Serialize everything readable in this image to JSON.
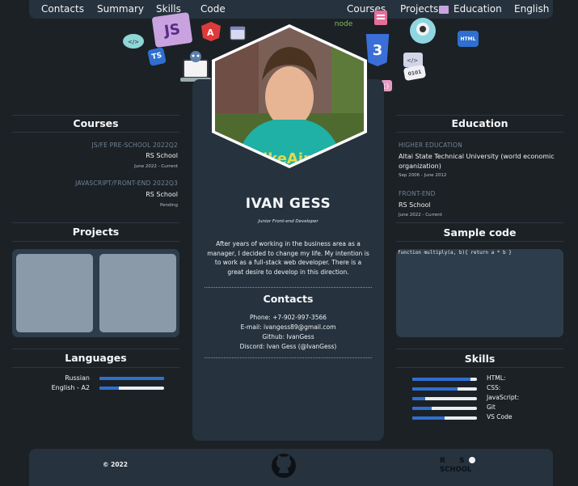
{
  "nav": {
    "left": [
      "Contacts",
      "Summary",
      "Skills",
      "Code"
    ],
    "right": [
      "Courses",
      "Projects",
      "Education",
      "English"
    ]
  },
  "decor": {
    "js": "JS",
    "ts": "TS",
    "html": "HTML",
    "css": "3",
    "node": "node",
    "num": "0101"
  },
  "courses": {
    "title": "Courses",
    "items": [
      {
        "name": "JS/FE PRE-SCHOOL 2022Q2",
        "org": "RS School",
        "period": "June 2022 - Current"
      },
      {
        "name": "JAVASCRIPT/FRONT-END 2022Q3",
        "org": "RS School",
        "period": "Pending"
      }
    ]
  },
  "projects": {
    "title": "Projects"
  },
  "languages": {
    "title": "Languages",
    "items": [
      {
        "name": "Russian",
        "level": 1.0
      },
      {
        "name": "English - A2",
        "level": 0.3
      }
    ]
  },
  "profile": {
    "name": "IVAN GESS",
    "role": "Junior Front-end Developer",
    "summary": "After years of working in the business area as a manager, I decided to change my life. My intention is to work as a full-stack web developer. There is a great desire to develop in this direction."
  },
  "contacts": {
    "title": "Contacts",
    "phone": "Phone: +7-902-997-3566",
    "email": "E-mail: ivangess89@gmail.com",
    "github": "Github: IvanGess",
    "discord": "Discord: Ivan Gess (@IvanGess)"
  },
  "education": {
    "title": "Education",
    "items": [
      {
        "type": "HIGHER EDUCATION",
        "name": "Altai State Technical University (world economic organization)",
        "period": "Sep 2006 - June 2012"
      },
      {
        "type": "FRONT-END",
        "name": "RS School",
        "period": "June 2022 - Current"
      }
    ]
  },
  "sample_code": {
    "title": "Sample code",
    "code": "function multiply(a, b){ return a * b }"
  },
  "skills": {
    "title": "Skills",
    "items": [
      {
        "name": "HTML:",
        "level": 0.9
      },
      {
        "name": "CSS:",
        "level": 0.7
      },
      {
        "name": "JavaScript:",
        "level": 0.2
      },
      {
        "name": "Git",
        "level": 0.3
      },
      {
        "name": "VS Code",
        "level": 0.5
      }
    ]
  },
  "footer": {
    "copyright": "© 2022",
    "rs_logo": "RS SCHOOL"
  },
  "colors": {
    "background": "#1c2126",
    "panel": "#26323d",
    "accent": "#2f6fd0",
    "placeholder": "#8a9aa8"
  }
}
